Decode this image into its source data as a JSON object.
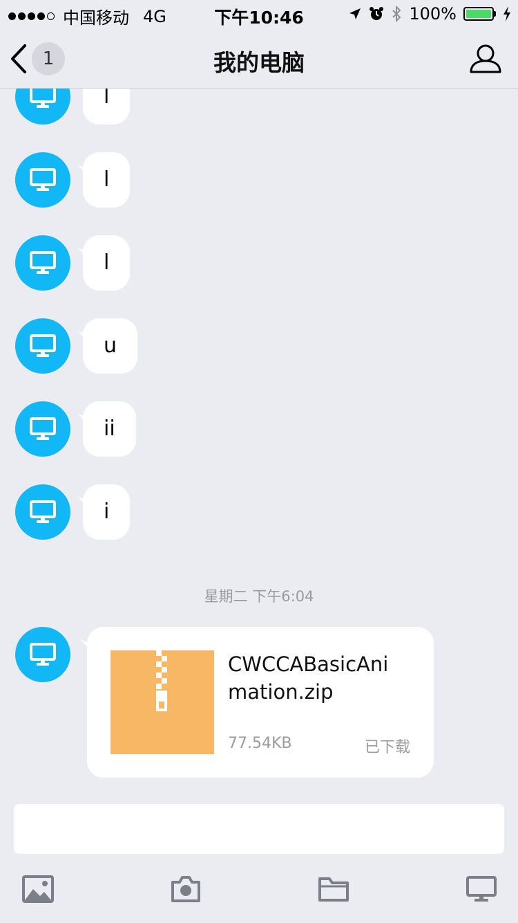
{
  "status_bar": {
    "carrier": "中国移动",
    "network": "4G",
    "time": "下午10:46",
    "battery": "100%"
  },
  "nav": {
    "back_badge": "1",
    "title": "我的电脑"
  },
  "messages": [
    {
      "text": "l"
    },
    {
      "text": "l"
    },
    {
      "text": "l"
    },
    {
      "text": "u"
    },
    {
      "text": "ii"
    },
    {
      "text": "i"
    }
  ],
  "timestamp": "星期二 下午6:04",
  "file_message": {
    "name": "CWCCABasicAnimation.zip",
    "size": "77.54KB",
    "status": "已下载"
  },
  "input": {
    "value": ""
  },
  "toolbar": {
    "icons": [
      "image-icon",
      "camera-icon",
      "folder-icon",
      "computer-icon"
    ]
  },
  "colors": {
    "avatar": "#12b7f5",
    "zip": "#f8b764",
    "background": "#ebecf1",
    "battery": "#4cd964",
    "toolbar_icon": "#7b7f8a"
  }
}
